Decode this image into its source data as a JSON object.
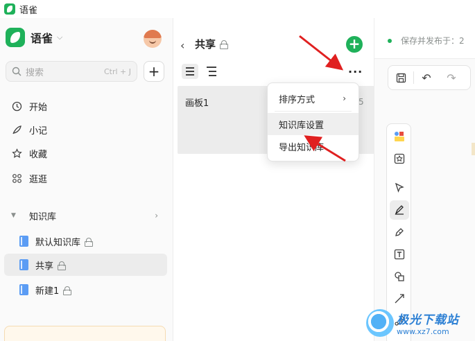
{
  "titlebar": {
    "title": "语雀"
  },
  "sidebar": {
    "brand": "语雀",
    "search": {
      "placeholder": "搜索",
      "shortcut": "Ctrl + J"
    },
    "nav": [
      {
        "label": "开始",
        "icon": "clock-icon"
      },
      {
        "label": "小记",
        "icon": "feather-icon"
      },
      {
        "label": "收藏",
        "icon": "star-icon"
      },
      {
        "label": "逛逛",
        "icon": "grid-icon"
      }
    ],
    "knowledge_base": {
      "label": "知识库",
      "items": [
        {
          "label": "默认知识库",
          "active": false
        },
        {
          "label": "共享",
          "active": true
        },
        {
          "label": "新建1",
          "active": false
        }
      ]
    }
  },
  "middle": {
    "title": "共享",
    "docs": [
      {
        "title": "画板1",
        "meta": "5"
      }
    ]
  },
  "menu": {
    "items": [
      {
        "label": "排序方式",
        "has_submenu": true
      },
      {
        "label": "知识库设置",
        "has_submenu": false
      },
      {
        "label": "导出知识库",
        "has_submenu": false
      }
    ]
  },
  "right": {
    "status": "保存并发布于：2",
    "toolbar": [
      "save-icon",
      "undo-icon",
      "redo-icon"
    ],
    "tools": [
      "sticker-icon",
      "star-frame-icon",
      "pointer-icon",
      "pen-icon",
      "marker-icon",
      "text-icon",
      "shape-icon",
      "line-icon",
      "connector-icon"
    ]
  },
  "watermark": {
    "name": "极光下载站",
    "url": "www.xz7.com"
  },
  "colors": {
    "brand_green": "#1fb15a",
    "arrow_red": "#e02020",
    "book_blue": "#5b9cf4"
  }
}
